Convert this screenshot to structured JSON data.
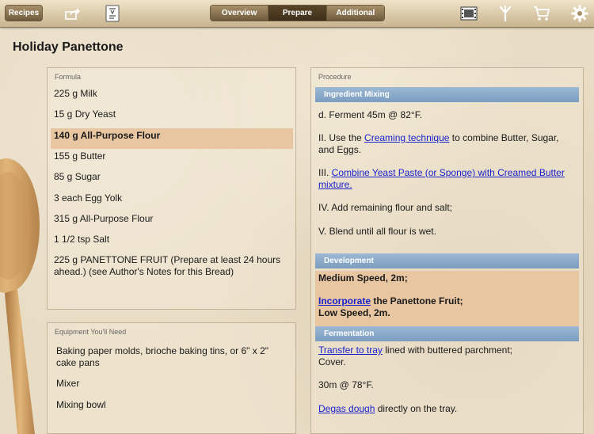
{
  "toolbar": {
    "recipes_label": "Recipes",
    "tabs": [
      {
        "label": "Overview",
        "active": false
      },
      {
        "label": "Prepare",
        "active": true
      },
      {
        "label": "Additional",
        "active": false
      }
    ],
    "icons": [
      "share-icon",
      "recipe-card-icon",
      "film-icon",
      "tools-icon",
      "cart-icon",
      "gear-icon"
    ]
  },
  "title": "Holiday Panettone",
  "formula": {
    "label": "Formula",
    "items": [
      "225 g Milk",
      "15 g Dry Yeast",
      "140 g All-Purpose Flour",
      "155 g Butter",
      "85 g Sugar",
      "3 each Egg Yolk",
      "315 g All-Purpose Flour",
      "1 1/2 tsp Salt",
      "225 g PANETTONE FRUIT (Prepare at least 24 hours ahead.)  (see Author's Notes for this Bread)"
    ],
    "highlighted_index": 2
  },
  "equipment": {
    "label": "Equipment You'll Need",
    "items": [
      "Baking paper molds, brioche baking tins, or 6\" x 2\" cake pans",
      "Mixer",
      "Mixing bowl"
    ]
  },
  "procedure": {
    "label": "Procedure",
    "mixing": {
      "header": "Ingredient Mixing",
      "step_d": "d. Ferment 45m @ 82°F.",
      "step2_pre": "II. Use the ",
      "step2_link": "Creaming technique",
      "step2_post": " to combine Butter, Sugar, and Eggs.",
      "step3_pre": "III. ",
      "step3_link": "Combine Yeast Paste (or Sponge) with Creamed Butter mixture.",
      "step4": "IV.  Add remaining flour and salt;",
      "step5": "V.  Blend until all flour is wet."
    },
    "development": {
      "header": "Development",
      "line1": "Medium Speed, 2m;",
      "line2_link": "Incorporate",
      "line2_post": " the Panettone Fruit;",
      "line3": "Low Speed, 2m."
    },
    "fermentation": {
      "header": "Fermentation",
      "line1_link": "Transfer to tray",
      "line1_post": " lined with buttered parchment;",
      "line1b": "Cover.",
      "line2": "30m @ 78°F.",
      "line3_link": "Degas dough",
      "line3_post": " directly on the tray."
    }
  },
  "colors": {
    "highlight": "#e8c6a2",
    "section_header": "#8aaccc",
    "link": "#1a22cc"
  }
}
